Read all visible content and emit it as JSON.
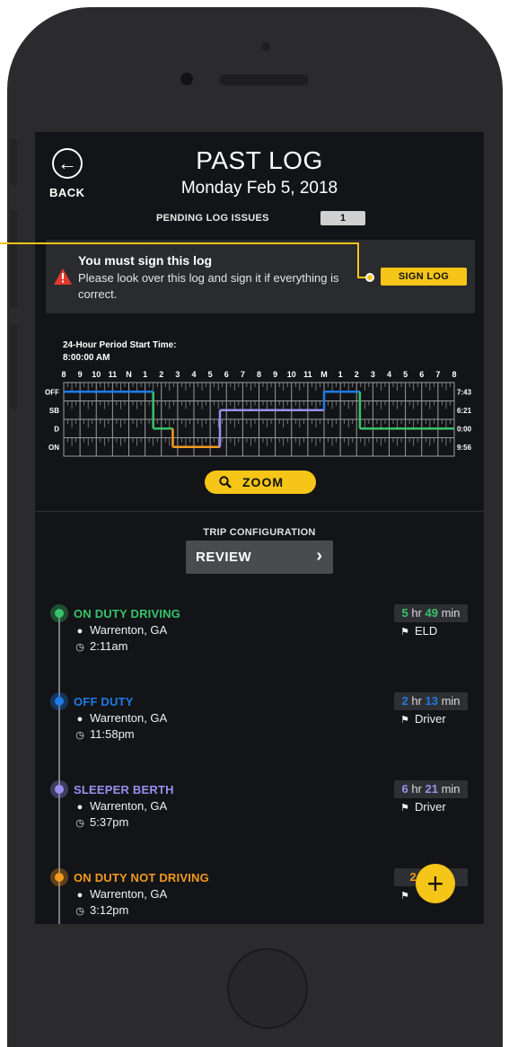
{
  "header": {
    "title": "PAST LOG",
    "date": "Monday Feb 5, 2018",
    "back_label": "BACK"
  },
  "pending": {
    "label": "PENDING LOG ISSUES",
    "count": "1"
  },
  "alert": {
    "title": "You must sign this log",
    "message": "Please look over this log and sign it if everything is correct.",
    "button": "SIGN LOG",
    "icon": "warning-triangle-icon"
  },
  "log_graph": {
    "period_label": "24-Hour Period Start Time:",
    "period_time": "8:00:00 AM",
    "hour_labels": [
      "8",
      "9",
      "10",
      "11",
      "N",
      "1",
      "2",
      "3",
      "4",
      "5",
      "6",
      "7",
      "8",
      "9",
      "10",
      "11",
      "M",
      "1",
      "2",
      "3",
      "4",
      "5",
      "6",
      "7",
      "8"
    ],
    "rows": [
      {
        "label": "OFF",
        "total": "7:43"
      },
      {
        "label": "SB",
        "total": "6:21"
      },
      {
        "label": "D",
        "total": "0:00"
      },
      {
        "label": "ON",
        "total": "9:56"
      }
    ],
    "segments": [
      {
        "row": 0,
        "start": 0,
        "end": 5.5,
        "color": "#1e7be6"
      },
      {
        "row": 2,
        "start": 5.5,
        "end": 6.7,
        "color": "#36c36b"
      },
      {
        "row": 3,
        "start": 6.7,
        "end": 9.6,
        "color": "#f29a1f"
      },
      {
        "row": 1,
        "start": 9.6,
        "end": 16.0,
        "color": "#9b8ef0"
      },
      {
        "row": 0,
        "start": 16.0,
        "end": 18.2,
        "color": "#1e7be6"
      },
      {
        "row": 2,
        "start": 18.2,
        "end": 24,
        "color": "#36c36b"
      }
    ],
    "colors": {
      "grid": "#9a9a9a",
      "off": "#1e7be6",
      "sb": "#9b8ef0",
      "d": "#36c36b",
      "on": "#f29a1f"
    }
  },
  "zoom": {
    "label": "ZOOM"
  },
  "trip": {
    "label": "TRIP CONFIGURATION",
    "button": "REVIEW"
  },
  "timeline": [
    {
      "status": "ON DUTY DRIVING",
      "color": "#36c36b",
      "location": "Warrenton, GA",
      "time": "2:11am",
      "dur_h": "5",
      "dur_m": "49",
      "source": "ELD"
    },
    {
      "status": "OFF DUTY",
      "color": "#1e7be6",
      "location": "Warrenton, GA",
      "time": "11:58pm",
      "dur_h": "2",
      "dur_m": "13",
      "source": "Driver"
    },
    {
      "status": "SLEEPER BERTH",
      "color": "#9b8ef0",
      "location": "Warrenton, GA",
      "time": "5:37pm",
      "dur_h": "6",
      "dur_m": "21",
      "source": "Driver"
    },
    {
      "status": "ON DUTY NOT DRIVING",
      "color": "#f29a1f",
      "location": "Warrenton, GA",
      "time": "3:12pm",
      "dur_h": "2",
      "dur_m": "",
      "source": ""
    }
  ],
  "fab": {
    "label": "+"
  },
  "theme": {
    "accent": "#f5c518",
    "background": "#131417",
    "panel": "#2a2b2e"
  }
}
